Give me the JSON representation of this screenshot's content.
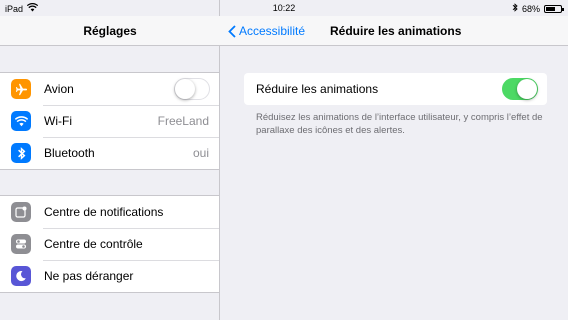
{
  "status_bar": {
    "device": "iPad",
    "time": "10:22",
    "battery": "68%",
    "battery_level": 0.68
  },
  "left": {
    "title": "Réglages",
    "group1": [
      {
        "id": "avion",
        "label": "Avion",
        "icon": "airplane-icon",
        "color": "#ff9500",
        "toggle": false
      },
      {
        "id": "wifi",
        "label": "Wi-Fi",
        "value": "FreeLand",
        "icon": "wifi-icon",
        "color": "#007aff"
      },
      {
        "id": "bluetooth",
        "label": "Bluetooth",
        "value": "oui",
        "icon": "bluetooth-icon",
        "color": "#007aff"
      }
    ],
    "group2": [
      {
        "id": "notifications",
        "label": "Centre de notifications",
        "icon": "notifications-icon",
        "color": "#8e8e93"
      },
      {
        "id": "controle",
        "label": "Centre de contrôle",
        "icon": "control-center-icon",
        "color": "#8e8e93"
      },
      {
        "id": "nepasderanger",
        "label": "Ne pas déranger",
        "icon": "moon-icon",
        "color": "#5856d6"
      }
    ]
  },
  "right": {
    "back_label": "Accessibilité",
    "title": "Réduire les animations",
    "setting_label": "Réduire les animations",
    "setting_on": true,
    "footnote": "Réduisez les animations de l’interface utilisateur, y compris l’effet de parallaxe des icônes et des alertes."
  }
}
